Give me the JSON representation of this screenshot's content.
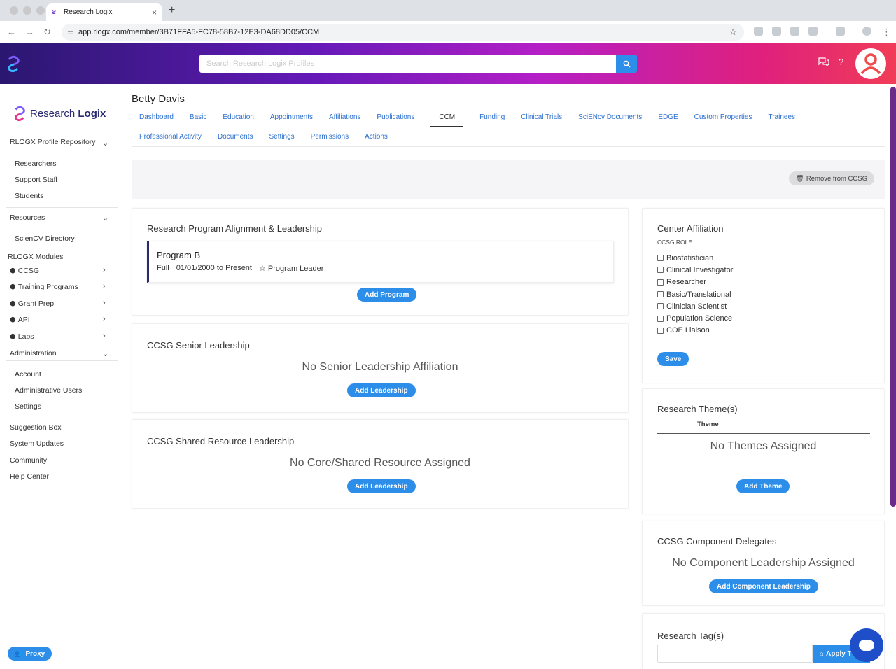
{
  "browser": {
    "tab_title": "Research Logix",
    "new_tab": "+",
    "close": "×",
    "url": "app.rlogx.com/member/3B71FFA5-FC78-58B7-12E3-DA68DD05/CCM"
  },
  "header": {
    "search_placeholder": "Search Research Logix Profiles",
    "help_label": "?"
  },
  "sidebar": {
    "brand_prefix": "Research ",
    "brand_bold": "Logix",
    "repository": "RLOGX Profile Repository",
    "repo_items": [
      "Researchers",
      "Support Staff",
      "Students"
    ],
    "resources": "Resources",
    "resources_items": [
      "ScienCV Directory"
    ],
    "modules_heading": "RLOGX Modules",
    "modules": [
      "CCSG",
      "Training Programs",
      "Grant Prep",
      "API",
      "Labs"
    ],
    "administration": "Administration",
    "admin_items": [
      "Account",
      "Administrative Users",
      "Settings"
    ],
    "footer_links": [
      "Suggestion Box",
      "System Updates",
      "Community",
      "Help Center"
    ],
    "proxy_label": "Proxy"
  },
  "main": {
    "person_name": "Betty Davis",
    "tabs_row1": [
      "Dashboard",
      "Basic",
      "Education",
      "Appointments",
      "Affiliations",
      "Publications",
      "CCM",
      "Funding",
      "Clinical Trials",
      "SciENcv Documents",
      "EDGE",
      "Custom Properties",
      "Trainees"
    ],
    "tabs_row2": [
      "Professional Activity",
      "Documents",
      "Settings",
      "Permissions",
      "Actions"
    ],
    "active_tab": "CCM",
    "remove_button": "Remove from CCSG"
  },
  "alignment": {
    "title": "Research Program Alignment & Leadership",
    "program_name": "Program B",
    "membership": "Full",
    "dates": "01/01/2000 to Present",
    "role": "Program Leader",
    "add_button": "Add Program"
  },
  "senior": {
    "title": "CCSG Senior Leadership",
    "empty": "No Senior Leadership Affiliation",
    "add_button": "Add Leadership"
  },
  "shared": {
    "title": "CCSG Shared Resource Leadership",
    "empty": "No Core/Shared Resource Assigned",
    "add_button": "Add Leadership"
  },
  "center": {
    "title": "Center Affiliation",
    "role_label": "CCSG ROLE",
    "roles": [
      "Biostatistician",
      "Clinical Investigator",
      "Researcher",
      "Basic/Translational",
      "Clinician Scientist",
      "Population Science",
      "COE Liaison"
    ],
    "save_button": "Save"
  },
  "themes": {
    "title": "Research Theme(s)",
    "column": "Theme",
    "empty": "No Themes Assigned",
    "add_button": "Add Theme"
  },
  "delegates": {
    "title": "CCSG Component Delegates",
    "empty": "No Component Leadership Assigned",
    "add_button": "Add Component Leadership"
  },
  "tags": {
    "title": "Research Tag(s)",
    "apply_button": "Apply T"
  },
  "colors": {
    "accent_blue": "#2c8ee8",
    "brand_navy": "#2a2a6e",
    "header_gradient_start": "#2a1770",
    "header_gradient_end": "#f03c57"
  }
}
